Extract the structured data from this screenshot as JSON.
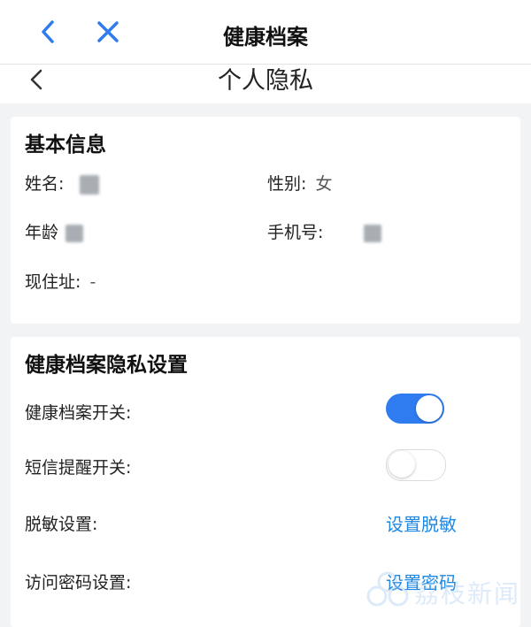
{
  "header": {
    "title": "健康档案",
    "back_icon": "chevron-left-icon",
    "close_icon": "close-icon",
    "accent": "#2f7cf0"
  },
  "subheader": {
    "title": "个人隐私",
    "back_icon": "chevron-left-icon"
  },
  "basic_info": {
    "title": "基本信息",
    "name_label": "姓名:",
    "gender_label": "性别:",
    "gender_value": "女",
    "age_label": "年龄",
    "phone_label": "手机号:",
    "address_label": "现住址:",
    "address_value": "-"
  },
  "privacy": {
    "title": "健康档案隐私设置",
    "archive_switch_label": "健康档案开关:",
    "archive_switch_on": true,
    "sms_switch_label": "短信提醒开关:",
    "sms_switch_on": false,
    "desensitize_label": "脱敏设置:",
    "desensitize_link": "设置脱敏",
    "password_label": "访问密码设置:",
    "password_link": "设置密码"
  },
  "watermark": {
    "text": "荔枝新闻"
  },
  "colors": {
    "link": "#1e88e5",
    "toggle_on": "#2f7cf0",
    "background": "#f2f3f5"
  }
}
